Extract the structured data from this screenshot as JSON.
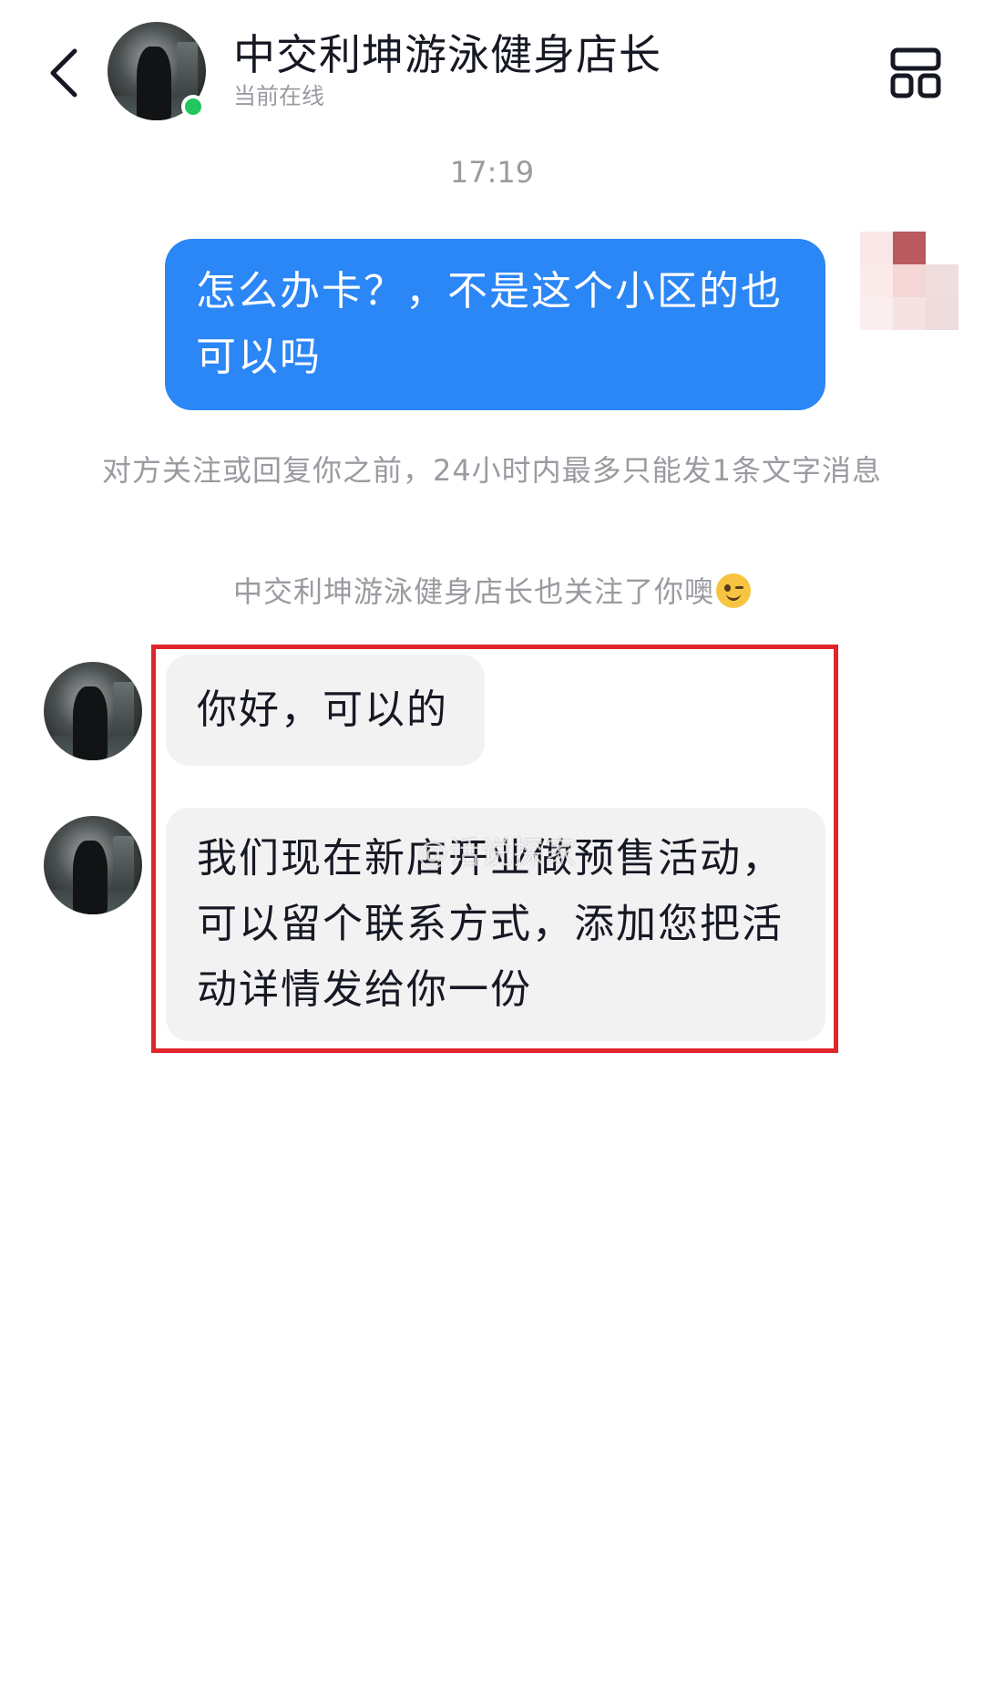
{
  "header": {
    "title": "中交利坤游泳健身店长",
    "status": "当前在线",
    "back_icon": "chevron-left-icon",
    "more_icon": "layout-grid-icon",
    "online_color": "#22c55e"
  },
  "chat": {
    "timestamp": "17:19",
    "outgoing": [
      {
        "text": "怎么办卡？，不是这个小区的也可以吗"
      }
    ],
    "system_notice": "对方关注或回复你之前，24小时内最多只能发1条文字消息",
    "follow_notice": "中交利坤游泳健身店长也关注了你噢",
    "incoming": [
      {
        "text": "你好，可以的"
      },
      {
        "text": "我们现在新店开业做预售活动，可以留个联系方式，添加您把活动详情发给你一份"
      }
    ],
    "watermark": "@话说探家"
  },
  "colors": {
    "outgoing_bubble": "#2b86f6",
    "incoming_bubble": "#f2f2f3",
    "highlight": "#e0262b"
  }
}
